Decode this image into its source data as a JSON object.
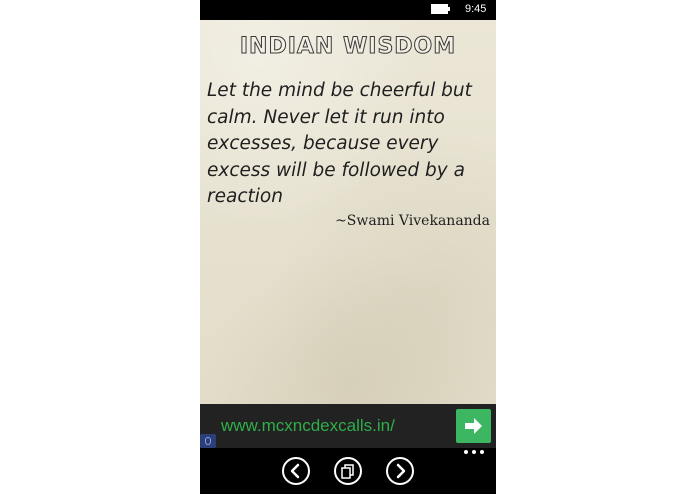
{
  "status_bar": {
    "time": "9:45",
    "battery_icon": "battery-icon"
  },
  "content": {
    "app_title": "INDIAN WISDOM",
    "quote": "Let the mind be cheerful but calm. Never let it run into excesses, because every excess will be followed by a reaction",
    "author": "~Swami Vivekananda"
  },
  "ad": {
    "url": "www.mcxncdexcalls.in/",
    "go_icon": "arrow-right-icon",
    "info_icon": "ad-info-icon",
    "accent": "#3cb660",
    "url_color": "#2fae4a"
  },
  "app_bar": {
    "buttons": [
      {
        "icon": "back-arrow-icon"
      },
      {
        "icon": "copy-icon"
      },
      {
        "icon": "forward-arrow-icon"
      }
    ],
    "more_icon": "more-dots-icon"
  }
}
